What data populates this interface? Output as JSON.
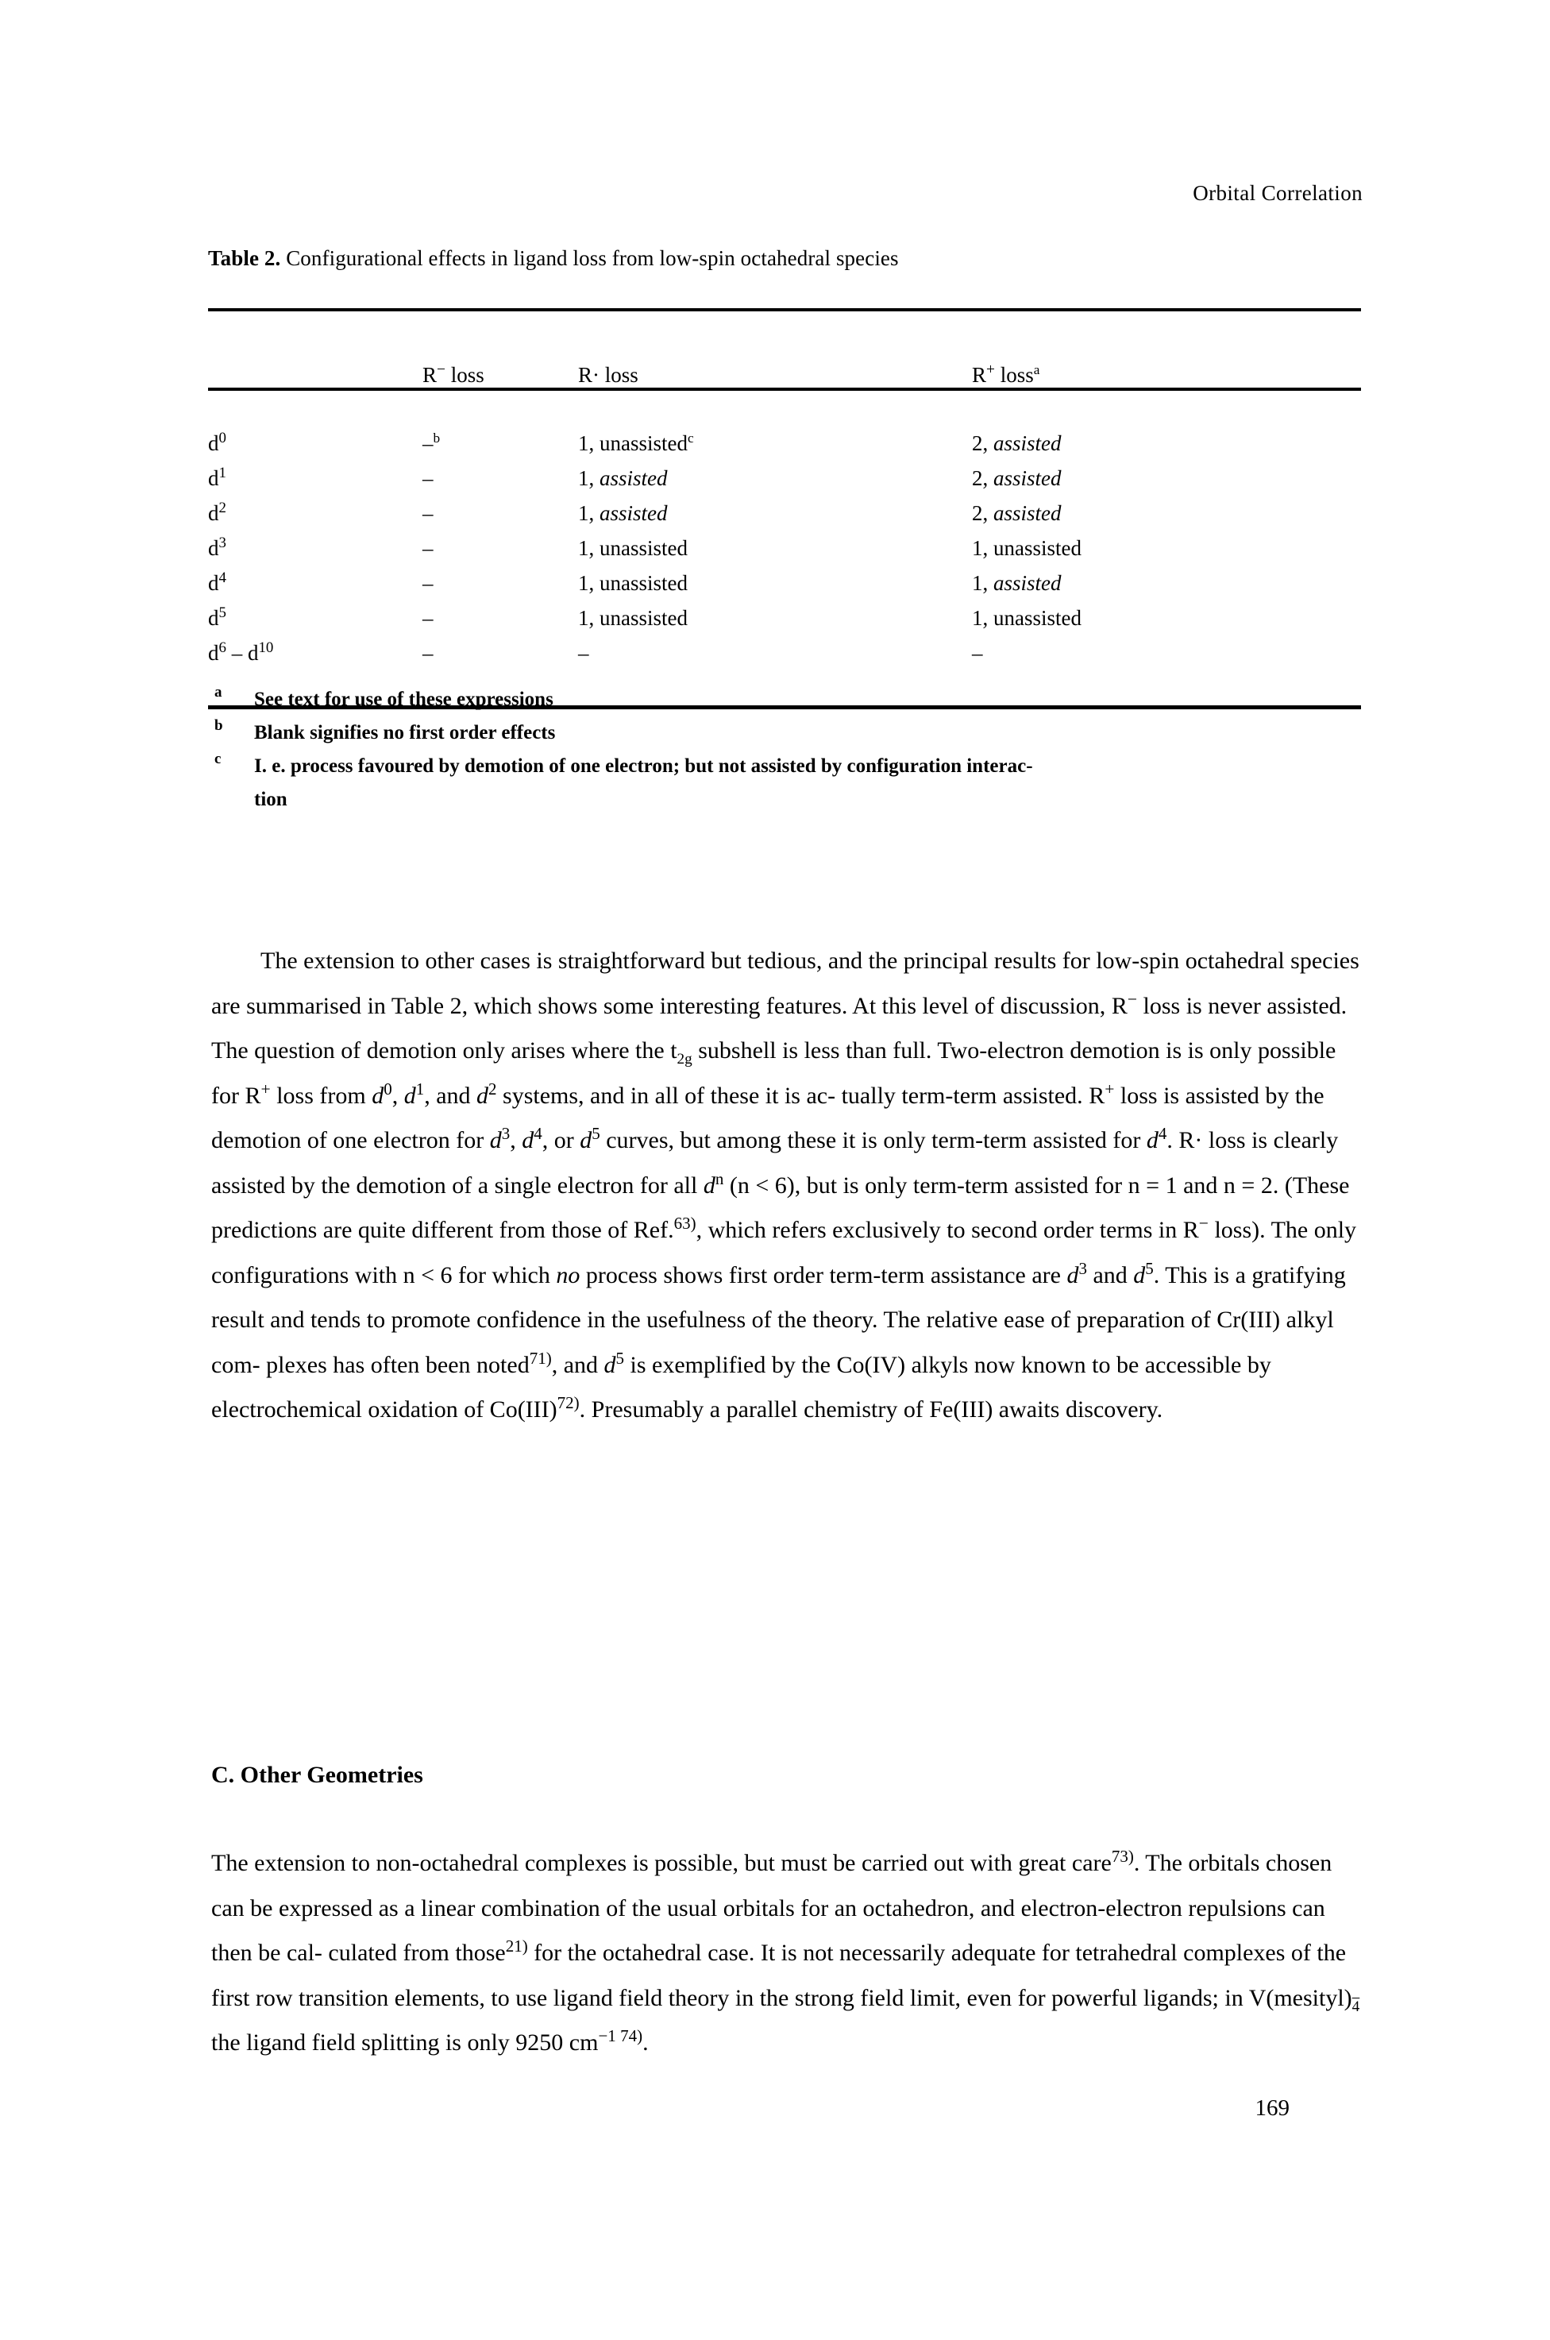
{
  "header": {
    "running_title": "Orbital Correlation"
  },
  "table": {
    "label": "Table 2.",
    "caption": "Configurational effects in ligand loss from low-spin octahedral species",
    "columns": [
      {
        "key": "config",
        "label": ""
      },
      {
        "key": "r_minus",
        "label": "R− loss",
        "base": "R",
        "sign": "−",
        "rest": " loss",
        "footnote": ""
      },
      {
        "key": "r_dot",
        "label": "R· loss",
        "base": "R·",
        "sign": "",
        "rest": " loss",
        "footnote": ""
      },
      {
        "key": "r_plus",
        "label": "R+ lossa",
        "base": "R",
        "sign": "+",
        "rest": " loss",
        "footnote": "a"
      }
    ],
    "rows": [
      {
        "config": "d0",
        "config_base": "d",
        "config_exp": "0",
        "config_range": "",
        "r_minus": "–",
        "r_minus_fn": "b",
        "r_dot": "1, unassisted",
        "r_dot_fn": "c",
        "r_dot_italic": false,
        "r_plus_num": "2, ",
        "r_plus_word": "assisted",
        "r_plus_italic": true
      },
      {
        "config": "d1",
        "config_base": "d",
        "config_exp": "1",
        "config_range": "",
        "r_minus": "–",
        "r_minus_fn": "",
        "r_dot_num": "1, ",
        "r_dot_word": "assisted",
        "r_dot_italic": true,
        "r_plus_num": "2, ",
        "r_plus_word": "assisted",
        "r_plus_italic": true
      },
      {
        "config": "d2",
        "config_base": "d",
        "config_exp": "2",
        "config_range": "",
        "r_minus": "–",
        "r_minus_fn": "",
        "r_dot_num": "1, ",
        "r_dot_word": "assisted",
        "r_dot_italic": true,
        "r_plus_num": "2, ",
        "r_plus_word": "assisted",
        "r_plus_italic": true
      },
      {
        "config": "d3",
        "config_base": "d",
        "config_exp": "3",
        "config_range": "",
        "r_minus": "–",
        "r_minus_fn": "",
        "r_dot_num": "1, ",
        "r_dot_word": "unassisted",
        "r_dot_italic": false,
        "r_plus_num": "1, ",
        "r_plus_word": "unassisted",
        "r_plus_italic": false
      },
      {
        "config": "d4",
        "config_base": "d",
        "config_exp": "4",
        "config_range": "",
        "r_minus": "–",
        "r_minus_fn": "",
        "r_dot_num": "1, ",
        "r_dot_word": "unassisted",
        "r_dot_italic": false,
        "r_plus_num": "1, ",
        "r_plus_word": "assisted",
        "r_plus_italic": true
      },
      {
        "config": "d5",
        "config_base": "d",
        "config_exp": "5",
        "config_range": "",
        "r_minus": "–",
        "r_minus_fn": "",
        "r_dot_num": "1, ",
        "r_dot_word": "unassisted",
        "r_dot_italic": false,
        "r_plus_num": "1, ",
        "r_plus_word": "unassisted",
        "r_plus_italic": false
      },
      {
        "config": "d6 - d10",
        "config_base": "d",
        "config_exp": "6",
        "config_range": "10",
        "r_minus": "–",
        "r_minus_fn": "",
        "r_dot_num": "–",
        "r_dot_word": "",
        "r_dot_italic": false,
        "r_plus_num": "–",
        "r_plus_word": "",
        "r_plus_italic": false
      }
    ],
    "footnotes": [
      {
        "mark": "a",
        "text": "See text for use of these expressions",
        "cont": ""
      },
      {
        "mark": "b",
        "text": "Blank signifies no first order effects",
        "cont": ""
      },
      {
        "mark": "c",
        "text": "I. e. process favoured by demotion of one electron; but not assisted by configuration interac-",
        "cont": "tion"
      }
    ]
  },
  "body": {
    "paragraph_1_lines": [
      "The extension to other cases is straightforward but tedious, and the principal",
      "results for low-spin octahedral species are summarised in Table 2, which shows some",
      "interesting features. At this level of discussion, R− loss is never assisted. The question",
      "of demotion only arises where the t2g subshell is less than full. Two-electron demotion is",
      "is only possible for R+ loss from d0, d1, and d2 systems, and in all of these it is ac-",
      "tually term-term assisted. R+ loss is assisted by the demotion of one electron for d3,",
      "d4, or d5 curves, but among these it is only term-term assisted for d4. R· loss is",
      "clearly assisted by the demotion of a single electron for all dn (n < 6), but is only",
      "term-term assisted for n = 1 and n = 2. (These predictions are quite different from",
      "those of Ref.63), which refers exclusively to second order terms in R− loss). The",
      "only configurations with n < 6 for which no process shows first order term-term",
      "assistance are d3 and d5. This is a gratifying result and tends to promote confidence",
      "in the usefulness of the theory. The relative ease of preparation of Cr(III) alkyl com-",
      "plexes has often been noted71), and d5 is exemplified by the Co(IV) alkyls now",
      "known to be accessible by electrochemical oxidation of Co(III)72). Presumably a",
      "parallel chemistry of Fe(III) awaits discovery."
    ],
    "section_heading": "C. Other Geometries",
    "paragraph_2_lines": [
      "The extension to non-octahedral complexes is possible, but must be carried out with",
      "great care73). The orbitals chosen can be expressed as a linear combination of the",
      "usual orbitals for an octahedron, and electron-electron repulsions can then be cal-",
      "culated from those21) for the octahedral case. It is not necessarily adequate for",
      "tetrahedral complexes of the first row transition elements, to use ligand field theory",
      "in the strong field limit, even for powerful ligands; in V(mesityl)4− the ligand field",
      "splitting is only 9250 cm−1 74)."
    ],
    "refs": {
      "r63": "63)",
      "r71": "71)",
      "r72": "72)",
      "r73": "73)",
      "r21": "21)",
      "r74": "74)"
    }
  },
  "page_number": "169",
  "colors": {
    "text": "#000000",
    "background": "#ffffff",
    "rule": "#000000"
  }
}
